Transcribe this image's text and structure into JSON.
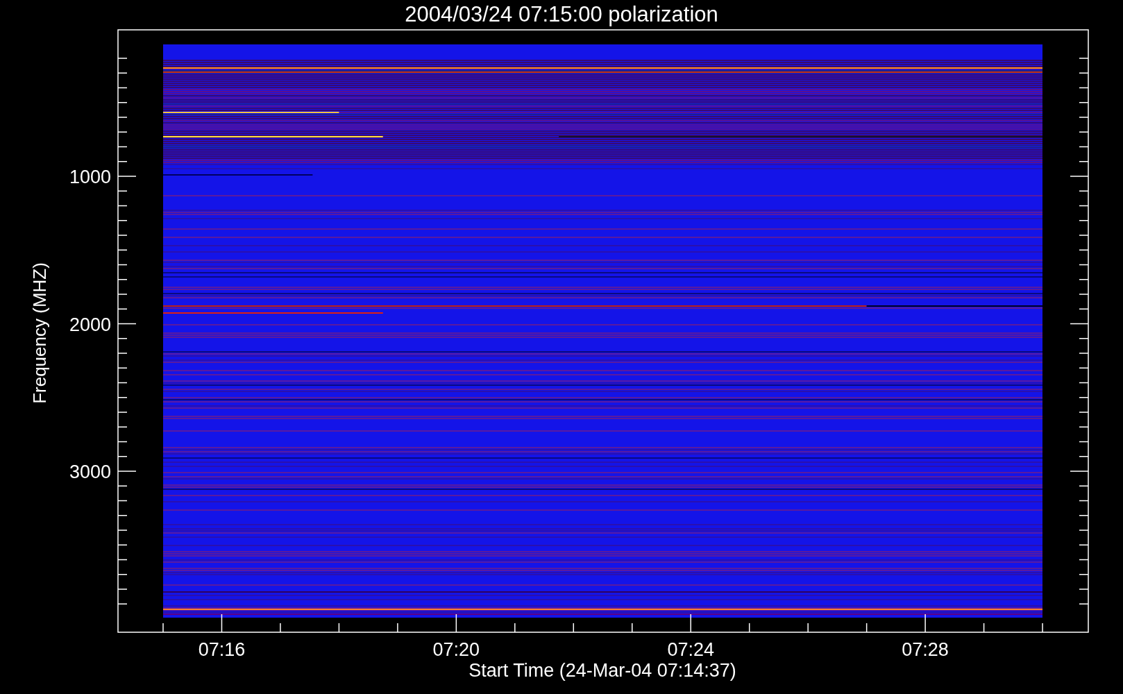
{
  "title": "2004/03/24 07:15:00 polarization",
  "y_axis": {
    "label": "Frequency (MHZ)",
    "tick_labels": [
      "1000",
      "2000",
      "3000"
    ]
  },
  "x_axis": {
    "label": "Start Time (24-Mar-04 07:14:37)",
    "tick_labels": [
      "07:16",
      "07:20",
      "07:24",
      "07:28"
    ]
  }
}
